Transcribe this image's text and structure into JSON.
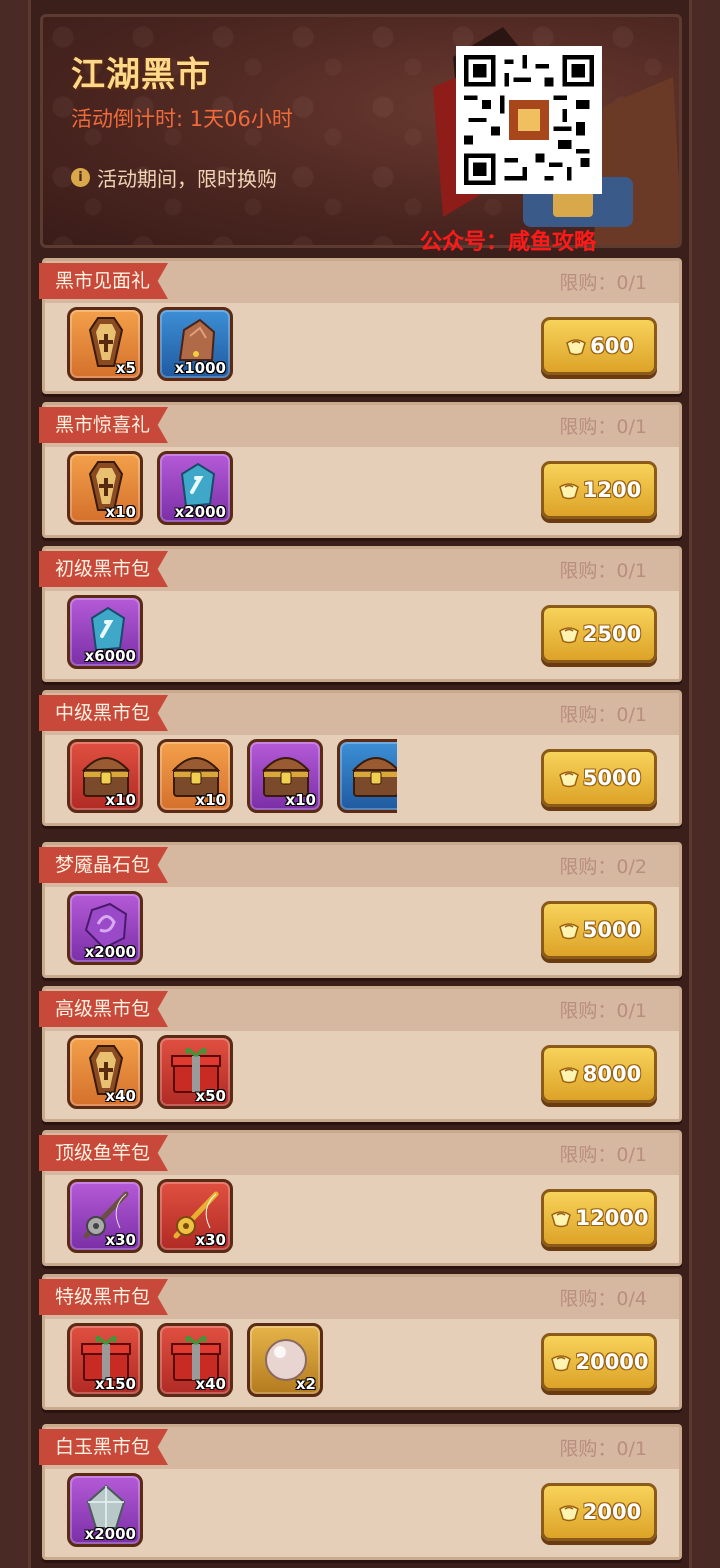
{
  "banner": {
    "title": "江湖黑市",
    "countdown": "活动倒计时: 1天06小时",
    "note": "活动期间，限时换购",
    "watermark": "公众号：咸鱼攻略"
  },
  "colors": {
    "ribbon": "#c8493a",
    "price_button": "#f0c040",
    "countdown": "#f06a3a",
    "watermark": "#ff1a1a"
  },
  "packs": [
    {
      "name": "黑市见面礼",
      "limit": "限购：0/1",
      "price": "600",
      "items": [
        {
          "icon": "coffin-icon",
          "qty": "x5",
          "bg": "orange"
        },
        {
          "icon": "ore-icon",
          "qty": "x1000",
          "bg": "blue"
        }
      ]
    },
    {
      "name": "黑市惊喜礼",
      "limit": "限购：0/1",
      "price": "1200",
      "items": [
        {
          "icon": "coffin-icon",
          "qty": "x10",
          "bg": "orange"
        },
        {
          "icon": "crystal-icon",
          "qty": "x2000",
          "bg": "purple"
        }
      ]
    },
    {
      "name": "初级黑市包",
      "limit": "限购：0/1",
      "price": "2500",
      "items": [
        {
          "icon": "crystal-icon",
          "qty": "x6000",
          "bg": "purple"
        }
      ]
    },
    {
      "name": "中级黑市包",
      "limit": "限购：0/1",
      "price": "5000",
      "items": [
        {
          "icon": "chest-icon",
          "qty": "x10",
          "bg": "red"
        },
        {
          "icon": "chest-icon",
          "qty": "x10",
          "bg": "orange"
        },
        {
          "icon": "chest-icon",
          "qty": "x10",
          "bg": "purple"
        },
        {
          "icon": "chest-icon",
          "qty": "",
          "bg": "blue"
        }
      ]
    },
    {
      "name": "梦魇晶石包",
      "limit": "限购：0/2",
      "price": "5000",
      "items": [
        {
          "icon": "nightmare-stone-icon",
          "qty": "x2000",
          "bg": "purple"
        }
      ]
    },
    {
      "name": "高级黑市包",
      "limit": "限购：0/1",
      "price": "8000",
      "items": [
        {
          "icon": "coffin-icon",
          "qty": "x40",
          "bg": "orange"
        },
        {
          "icon": "gift-box-icon",
          "qty": "x50",
          "bg": "red"
        }
      ]
    },
    {
      "name": "顶级鱼竿包",
      "limit": "限购：0/1",
      "price": "12000",
      "items": [
        {
          "icon": "fishing-rod-icon",
          "qty": "x30",
          "bg": "purple"
        },
        {
          "icon": "golden-rod-icon",
          "qty": "x30",
          "bg": "red"
        }
      ]
    },
    {
      "name": "特级黑市包",
      "limit": "限购：0/4",
      "price": "20000",
      "items": [
        {
          "icon": "gift-box-icon",
          "qty": "x150",
          "bg": "red"
        },
        {
          "icon": "gift-box-icon",
          "qty": "x40",
          "bg": "red"
        },
        {
          "icon": "pearl-icon",
          "qty": "x2",
          "bg": "gold"
        }
      ]
    },
    {
      "name": "白玉黑市包",
      "limit": "限购：0/1",
      "price": "2000",
      "items": [
        {
          "icon": "white-jade-icon",
          "qty": "x2000",
          "bg": "purple"
        }
      ]
    }
  ]
}
